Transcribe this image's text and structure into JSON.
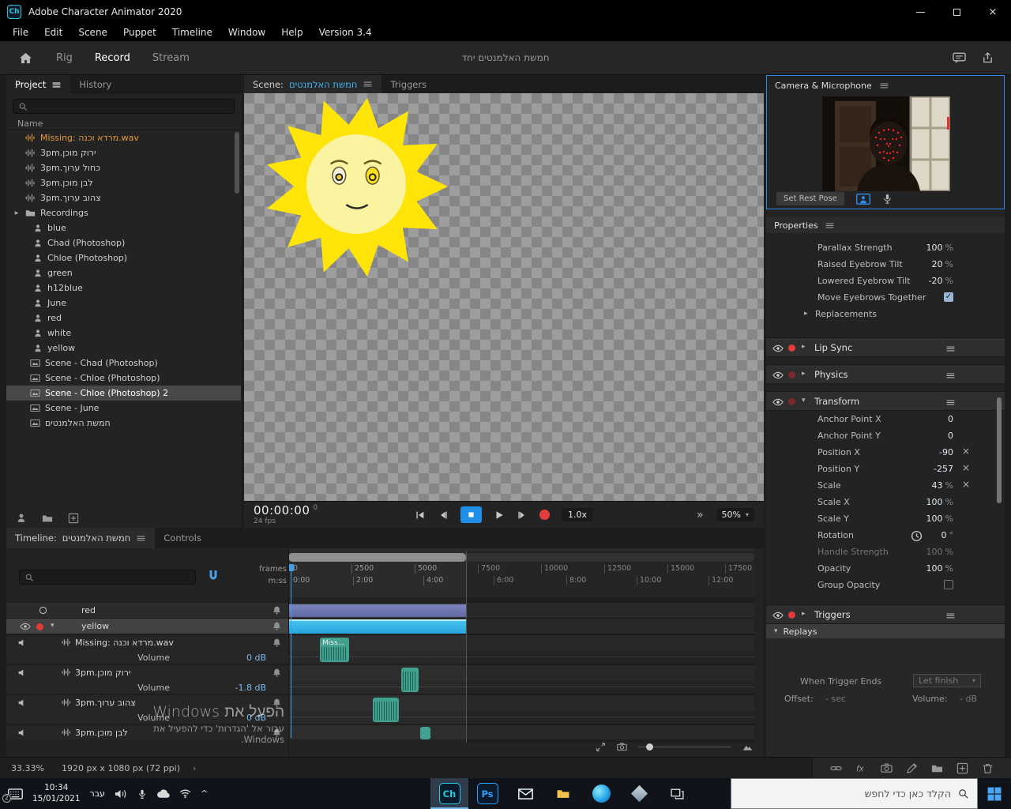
{
  "colors": {
    "accent_blue": "#2d8ceb",
    "scene_name_blue": "#3ab4f2",
    "timeline_cyan": "#2aa5dc",
    "clip_teal": "#41a08f",
    "missing_orange": "#e8973c",
    "record_red": "#e23c3c",
    "sun_yellow": "#ffe400"
  },
  "titlebar": {
    "app_badge": "Ch",
    "title": "Adobe Character Animator 2020"
  },
  "menubar": {
    "items": [
      "File",
      "Edit",
      "Scene",
      "Puppet",
      "Timeline",
      "Window",
      "Help",
      "Version 3.4"
    ]
  },
  "toolbar": {
    "tabs": [
      {
        "label": "Rig"
      },
      {
        "label": "Record"
      },
      {
        "label": "Stream"
      }
    ],
    "document_title": "חמשת האלמנטים יחד"
  },
  "project_panel": {
    "tabs": [
      {
        "label": "Project"
      },
      {
        "label": "History"
      }
    ],
    "name_header": "Name",
    "items": [
      {
        "label": "Missing: מרדא וכנה.wav",
        "type": "audio",
        "missing": true
      },
      {
        "label": "3pm.ירוק מוכן",
        "type": "audio"
      },
      {
        "label": "3pm.כחול ערוך",
        "type": "audio"
      },
      {
        "label": "3pm.לבן מוכן",
        "type": "audio"
      },
      {
        "label": "3pm.צהוב ערוך",
        "type": "audio"
      },
      {
        "label": "Recordings",
        "type": "folder"
      },
      {
        "label": "blue",
        "type": "puppet"
      },
      {
        "label": "Chad (Photoshop)",
        "type": "puppet"
      },
      {
        "label": "Chloe (Photoshop)",
        "type": "puppet"
      },
      {
        "label": "green",
        "type": "puppet"
      },
      {
        "label": "h12blue",
        "type": "puppet"
      },
      {
        "label": "June",
        "type": "puppet"
      },
      {
        "label": "red",
        "type": "puppet"
      },
      {
        "label": "white",
        "type": "puppet"
      },
      {
        "label": "yellow",
        "type": "puppet"
      },
      {
        "label": "Scene - Chad (Photoshop)",
        "type": "scene"
      },
      {
        "label": "Scene - Chloe (Photoshop)",
        "type": "scene"
      },
      {
        "label": "Scene - Chloe (Photoshop) 2",
        "type": "scene",
        "selected": true
      },
      {
        "label": "Scene - June",
        "type": "scene"
      },
      {
        "label": "חמשת האלמנטים",
        "type": "scene"
      }
    ]
  },
  "scene_panel": {
    "scene_tab_prefix": "Scene:",
    "scene_name": "חמשת האלמנטים",
    "triggers_tab": "Triggers"
  },
  "transport": {
    "timecode": "00:00:00",
    "frame": "0",
    "fps": "24 fps",
    "speed": "1.0x",
    "ff": "»",
    "zoom": "50%"
  },
  "camera_panel": {
    "title": "Camera & Microphone",
    "set_rest_pose": "Set Rest Pose"
  },
  "properties_panel": {
    "title": "Properties",
    "rows": [
      {
        "label": "Parallax Strength",
        "value": "100",
        "suffix": "%"
      },
      {
        "label": "Raised Eyebrow Tilt",
        "value": "20",
        "suffix": "%"
      },
      {
        "label": "Lowered Eyebrow Tilt",
        "value": "-20",
        "suffix": "%"
      },
      {
        "label": "Move Eyebrows Together",
        "check": "✓"
      },
      {
        "label": "Replacements"
      }
    ]
  },
  "behaviors": {
    "lip_sync": "Lip Sync",
    "physics": "Physics",
    "transform": "Transform",
    "triggers": "Triggers",
    "replays": "Replays"
  },
  "transform_rows": [
    {
      "label": "Anchor Point X",
      "value": "0",
      "suffix": ""
    },
    {
      "label": "Anchor Point Y",
      "value": "0",
      "suffix": ""
    },
    {
      "label": "Position X",
      "value": "-90",
      "suffix": ""
    },
    {
      "label": "Position Y",
      "value": "-257",
      "suffix": ""
    },
    {
      "label": "Scale",
      "value": "43",
      "suffix": "%"
    },
    {
      "label": "Scale X",
      "value": "100",
      "suffix": "%"
    },
    {
      "label": "Scale Y",
      "value": "100",
      "suffix": "%"
    },
    {
      "label": "Rotation",
      "value": "0",
      "suffix": "°"
    },
    {
      "label": "Handle Strength",
      "value": "100",
      "suffix": "%"
    },
    {
      "label": "Opacity",
      "value": "100",
      "suffix": "%"
    },
    {
      "label": "Group Opacity",
      "check": ""
    }
  ],
  "replay_options": {
    "when_trigger_ends": "When Trigger Ends",
    "let_finish": "Let finish",
    "offset_label": "Offset:",
    "offset_value": "- sec",
    "volume_label": "Volume:",
    "volume_value": "- dB"
  },
  "timeline_panel": {
    "timeline_tab_prefix": "Timeline:",
    "timeline_name": "חמשת האלמנטים",
    "controls_tab": "Controls",
    "frames_label": "frames",
    "mss_label": "m:ss",
    "frame_ticks": [
      "0",
      "2500",
      "5000",
      "7500",
      "10000",
      "12500",
      "15000",
      "17500"
    ],
    "time_ticks": [
      "0:00",
      "2:00",
      "4:00",
      "6:00",
      "8:00",
      "10:00",
      "12:00"
    ],
    "tracks": [
      {
        "name": "red",
        "type": "puppet"
      },
      {
        "name": "yellow",
        "type": "puppet",
        "selected": true
      },
      {
        "name": "Missing: מרדא וכנה.wav",
        "type": "audio",
        "volume_label": "Volume",
        "volume_value": "0 dB",
        "clip_label": "Miss..."
      },
      {
        "name": "3pm.ירוק מוכן",
        "type": "audio",
        "volume_label": "Volume",
        "volume_value": "-1.8 dB"
      },
      {
        "name": "3pm.צהוב ערוך",
        "type": "audio",
        "volume_label": "Volume",
        "volume_value": "0 dB"
      },
      {
        "name": "3pm.לבן מוכן",
        "type": "audio"
      }
    ]
  },
  "watermark": {
    "line1": "הפעל את Windows",
    "line2": "עבור אל 'הגדרות' כדי להפעיל את Windows."
  },
  "statusbar": {
    "zoom": "33.33%",
    "resolution": "1920 px x 1080 px (72 ppi)"
  },
  "taskbar": {
    "time": "10:34",
    "date": "15/01/2021",
    "lang": "עבר",
    "badge": "2",
    "search_placeholder": "הקלד כאן כדי לחפש",
    "app_ch": "Ch",
    "app_ps": "Ps"
  }
}
